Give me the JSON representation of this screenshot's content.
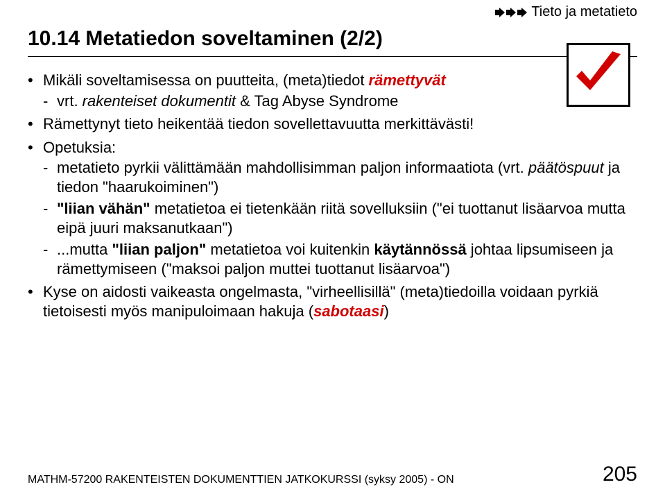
{
  "breadcrumb": {
    "label": "Tieto ja metatieto"
  },
  "title": "10.14 Metatiedon soveltaminen (2/2)",
  "bullets": {
    "b1_pre": "Mikäli soveltamisessa on puutteita, (meta)tiedot ",
    "b1_em": "rämettyvät",
    "b1_sub_pre": "vrt. ",
    "b1_sub_it": "rakenteiset dokumentit",
    "b1_sub_post": " & Tag Abyse Syndrome",
    "b2": "Rämettynyt tieto heikentää tiedon sovellettavuutta merkittävästi!",
    "b3": "Opetuksia:",
    "b3a_pre": "metatieto pyrkii välittämään mahdollisimman paljon informaatiota (vrt. ",
    "b3a_it": "päätöspuut",
    "b3a_post": " ja tiedon \"haarukoiminen\")",
    "b3b_q": "\"liian vähän\"",
    "b3b_post": " metatietoa ei tietenkään riitä sovelluksiin (\"ei tuottanut lisäarvoa mutta eipä juuri maksanutkaan\")",
    "b3c_pre": "...mutta ",
    "b3c_q": "\"liian paljon\"",
    "b3c_mid": " metatietoa voi kuitenkin ",
    "b3c_bold": "käytännössä",
    "b3c_post": " johtaa lipsumiseen ja rämettymiseen (\"maksoi paljon muttei tuottanut lisäarvoa\")",
    "b4_pre": "Kyse on aidosti vaikeasta ongelmasta, \"virheellisillä\" (meta)tiedoilla voidaan pyrkiä tietoisesti myös manipuloimaan hakuja (",
    "b4_em": "sabotaasi",
    "b4_post": ")"
  },
  "footer": {
    "course": "MATHM-57200 RAKENTEISTEN DOKUMENTTIEN JATKOKURSSI (syksy 2005) - ON",
    "page": "205"
  }
}
